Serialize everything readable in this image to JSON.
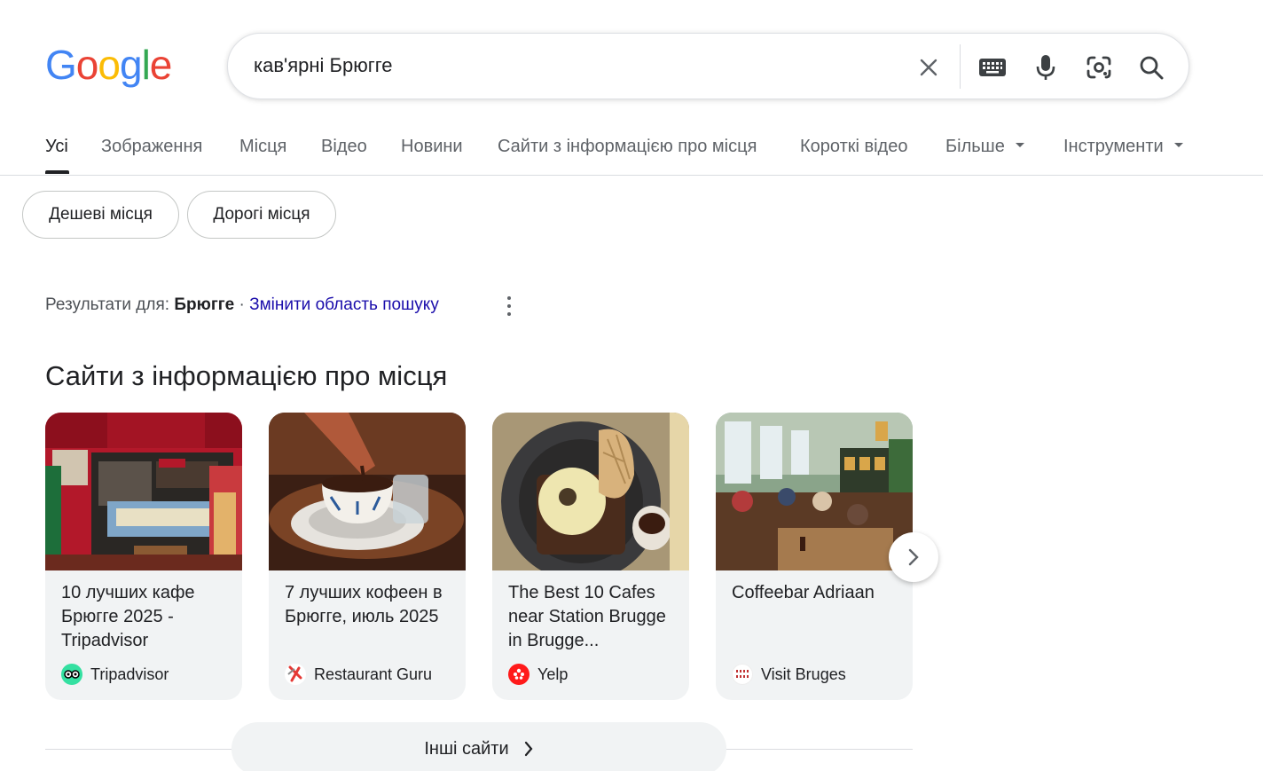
{
  "logo": {
    "letters": [
      "G",
      "o",
      "o",
      "g",
      "l",
      "e"
    ]
  },
  "search": {
    "query": "кав'ярні Брюгге",
    "icons": [
      "close-icon",
      "keyboard-icon",
      "microphone-icon",
      "lens-icon",
      "search-icon"
    ]
  },
  "tabs": [
    {
      "label": "Усі",
      "active": true
    },
    {
      "label": "Зображення"
    },
    {
      "label": "Місця"
    },
    {
      "label": "Відео"
    },
    {
      "label": "Новини"
    },
    {
      "label": "Сайти з інформацією про місця"
    },
    {
      "label": "Короткі відео"
    },
    {
      "label": "Більше",
      "dropdown": true
    },
    {
      "label": "Інструменти",
      "dropdown": true
    }
  ],
  "chips": [
    "Дешеві місця",
    "Дорогі місця"
  ],
  "results_for": {
    "prefix": "Результати для:",
    "location": "Брюгге",
    "separator": "·",
    "change_link": "Змінити область пошуку"
  },
  "section_title": "Сайти з інформацією про місця",
  "cards": [
    {
      "title": "10 лучших кафе Брюгге 2025 - Tripadvisor",
      "source": "Tripadvisor",
      "source_icon": "tripadvisor-icon",
      "source_color": "#34e0a1"
    },
    {
      "title": "7 лучших кофеен в Брюгге, июль 2025",
      "source": "Restaurant Guru",
      "source_icon": "restaurant-guru-icon",
      "source_color": "#e53935"
    },
    {
      "title": "The Best 10 Cafes near Station Brugge in Brugge...",
      "source": "Yelp",
      "source_icon": "yelp-icon",
      "source_color": "#ff1a1a"
    },
    {
      "title": "Coffeebar Adriaan",
      "source": "Visit Bruges",
      "source_icon": "visit-bruges-icon",
      "source_color": "#ffffff"
    }
  ],
  "more_sites": "Інші сайти",
  "colors": {
    "link": "#1a0dab",
    "text": "#202124",
    "muted": "#5f6368",
    "card_bg": "#f1f3f4"
  }
}
